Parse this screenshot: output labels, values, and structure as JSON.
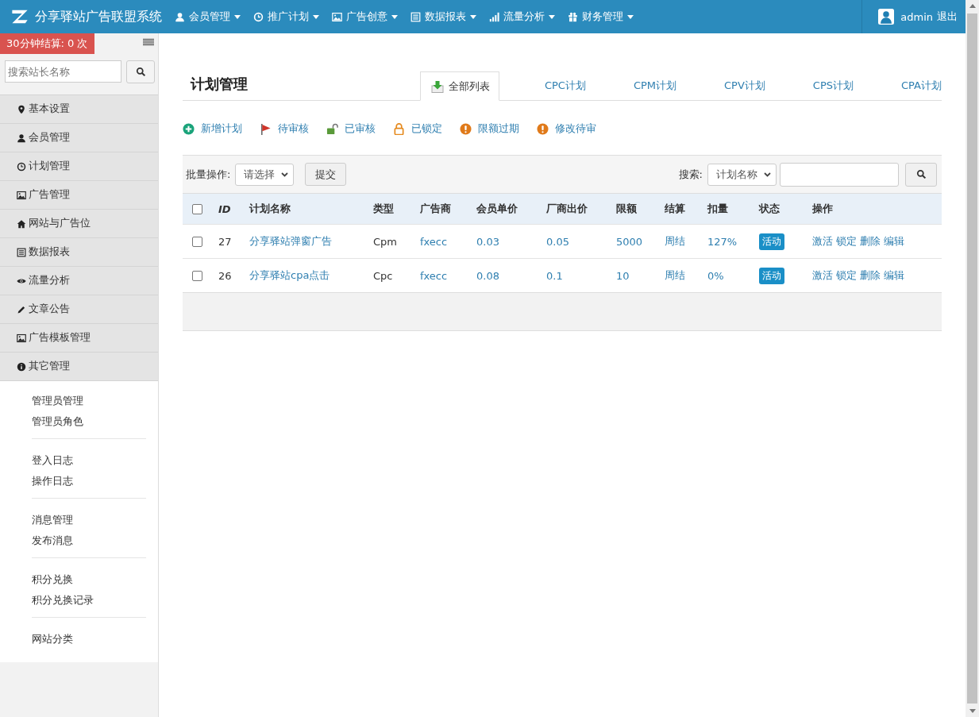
{
  "header": {
    "title": "分享驿站广告联盟系统",
    "menus": [
      "会员管理",
      "推广计划",
      "广告创意",
      "数据报表",
      "流量分析",
      "财务管理"
    ],
    "user": "admin",
    "logout": "退出"
  },
  "sidebar": {
    "settlement_badge": "30分钟结算: 0 次",
    "search": {
      "placeholder": "搜索站长名称"
    },
    "items": [
      {
        "label": "基本设置",
        "expanded": false
      },
      {
        "label": "会员管理",
        "expanded": false
      },
      {
        "label": "计划管理",
        "expanded": false
      },
      {
        "label": "广告管理",
        "expanded": false
      },
      {
        "label": "网站与广告位",
        "expanded": false
      },
      {
        "label": "数据报表",
        "expanded": false
      },
      {
        "label": "流量分析",
        "expanded": false
      },
      {
        "label": "文章公告",
        "expanded": false
      },
      {
        "label": "广告模板管理",
        "expanded": false
      },
      {
        "label": "其它管理",
        "expanded": true,
        "groups": [
          [
            "管理员管理",
            "管理员角色"
          ],
          [
            "登入日志",
            "操作日志"
          ],
          [
            "消息管理",
            "发布消息"
          ],
          [
            "积分兑换",
            "积分兑换记录"
          ],
          [
            "网站分类"
          ]
        ]
      }
    ]
  },
  "main": {
    "title": "计划管理",
    "tabs": [
      {
        "label": "全部列表",
        "selected": true
      },
      {
        "label": "CPC计划",
        "selected": false
      },
      {
        "label": "CPM计划",
        "selected": false
      },
      {
        "label": "CPV计划",
        "selected": false
      },
      {
        "label": "CPS计划",
        "selected": false
      },
      {
        "label": "CPA计划",
        "selected": false
      }
    ],
    "actions": [
      "新增计划",
      "待审核",
      "已审核",
      "已锁定",
      "限额过期",
      "修改待审"
    ],
    "table": {
      "batch_label": "批量操作:",
      "batch_select": "请选择",
      "submit": "提交",
      "search_label": "搜索:",
      "search_select": "计划名称",
      "select_all_checked": false,
      "columns": [
        "ID",
        "计划名称",
        "类型",
        "广告商",
        "会员单价",
        "厂商出价",
        "限额",
        "结算",
        "扣量",
        "状态",
        "操作"
      ],
      "rows": [
        {
          "checked": false,
          "id": "27",
          "name": "分享驿站弹窗广告",
          "type": "Cpm",
          "advertiser": "fxecc",
          "member_price": "0.03",
          "vendor_price": "0.05",
          "limit": "5000",
          "settlement": "周结",
          "deduction": "127%",
          "status": "活动",
          "actions": [
            "激活",
            "锁定",
            "删除",
            "编辑"
          ]
        },
        {
          "checked": false,
          "id": "26",
          "name": "分享驿站cpa点击",
          "type": "Cpc",
          "advertiser": "fxecc",
          "member_price": "0.08",
          "vendor_price": "0.1",
          "limit": "10",
          "settlement": "周结",
          "deduction": "0%",
          "status": "活动",
          "actions": [
            "激活",
            "锁定",
            "删除",
            "编辑"
          ]
        }
      ]
    }
  }
}
